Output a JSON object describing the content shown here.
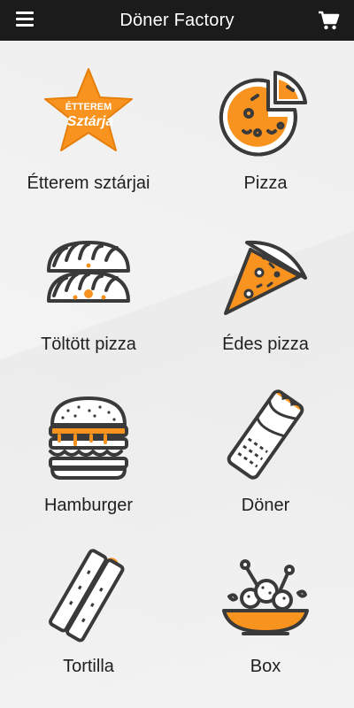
{
  "header": {
    "title": "Döner Factory",
    "menu_icon": "hamburger-menu-icon",
    "cart_icon": "shopping-cart-icon"
  },
  "colors": {
    "topbar": "#1b1b1b",
    "accent": "#f7931e",
    "outline": "#3a3a3a"
  },
  "categories": [
    {
      "label": "Étterem sztárjai",
      "icon": "star-badge-icon",
      "badge_line1": "ÉTTEREM",
      "badge_line2": "Sztárja"
    },
    {
      "label": "Pizza",
      "icon": "pizza-icon"
    },
    {
      "label": "Töltött pizza",
      "icon": "calzone-icon"
    },
    {
      "label": "Édes pizza",
      "icon": "pizza-slice-icon"
    },
    {
      "label": "Hamburger",
      "icon": "hamburger-icon"
    },
    {
      "label": "Döner",
      "icon": "doner-wrap-icon"
    },
    {
      "label": "Tortilla",
      "icon": "tortilla-wrap-icon"
    },
    {
      "label": "Box",
      "icon": "food-box-icon"
    }
  ]
}
